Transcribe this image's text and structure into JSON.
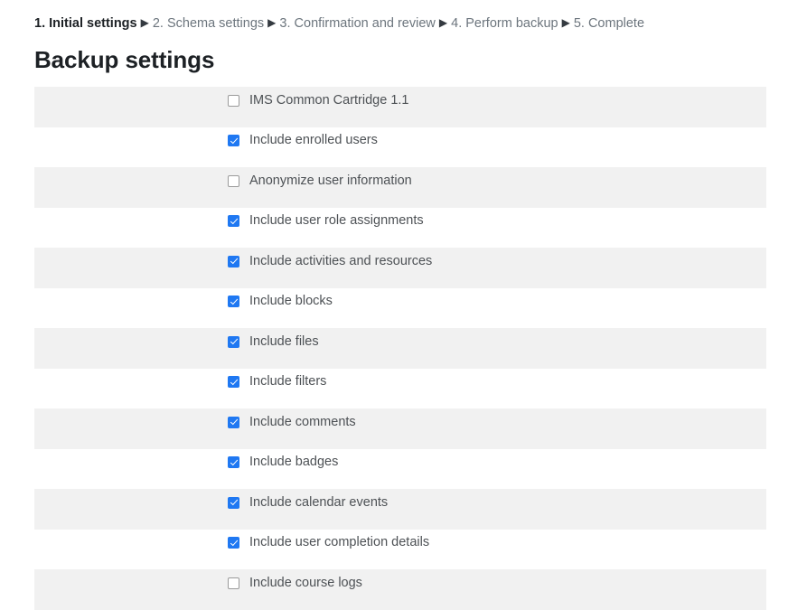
{
  "breadcrumb": {
    "separator": "▶",
    "steps": [
      {
        "label": "1. Initial settings",
        "active": true
      },
      {
        "label": "2. Schema settings",
        "active": false
      },
      {
        "label": "3. Confirmation and review",
        "active": false
      },
      {
        "label": "4. Perform backup",
        "active": false
      },
      {
        "label": "5. Complete",
        "active": false
      }
    ]
  },
  "heading": "Backup settings",
  "settings": [
    {
      "label": "IMS Common Cartridge 1.1",
      "checked": false,
      "striped": true
    },
    {
      "label": "Include enrolled users",
      "checked": true,
      "striped": false
    },
    {
      "label": "Anonymize user information",
      "checked": false,
      "striped": true
    },
    {
      "label": "Include user role assignments",
      "checked": true,
      "striped": false
    },
    {
      "label": "Include activities and resources",
      "checked": true,
      "striped": true
    },
    {
      "label": "Include blocks",
      "checked": true,
      "striped": false
    },
    {
      "label": "Include files",
      "checked": true,
      "striped": true
    },
    {
      "label": "Include filters",
      "checked": true,
      "striped": false
    },
    {
      "label": "Include comments",
      "checked": true,
      "striped": true
    },
    {
      "label": "Include badges",
      "checked": true,
      "striped": false
    },
    {
      "label": "Include calendar events",
      "checked": true,
      "striped": true
    },
    {
      "label": "Include user completion details",
      "checked": true,
      "striped": false
    },
    {
      "label": "Include course logs",
      "checked": false,
      "striped": true
    }
  ],
  "colors": {
    "accent": "#1f78f2",
    "stripe": "#f1f1f1",
    "text_dark": "#1d2125",
    "text_muted": "#6c757d",
    "label_text": "#4d5155"
  }
}
